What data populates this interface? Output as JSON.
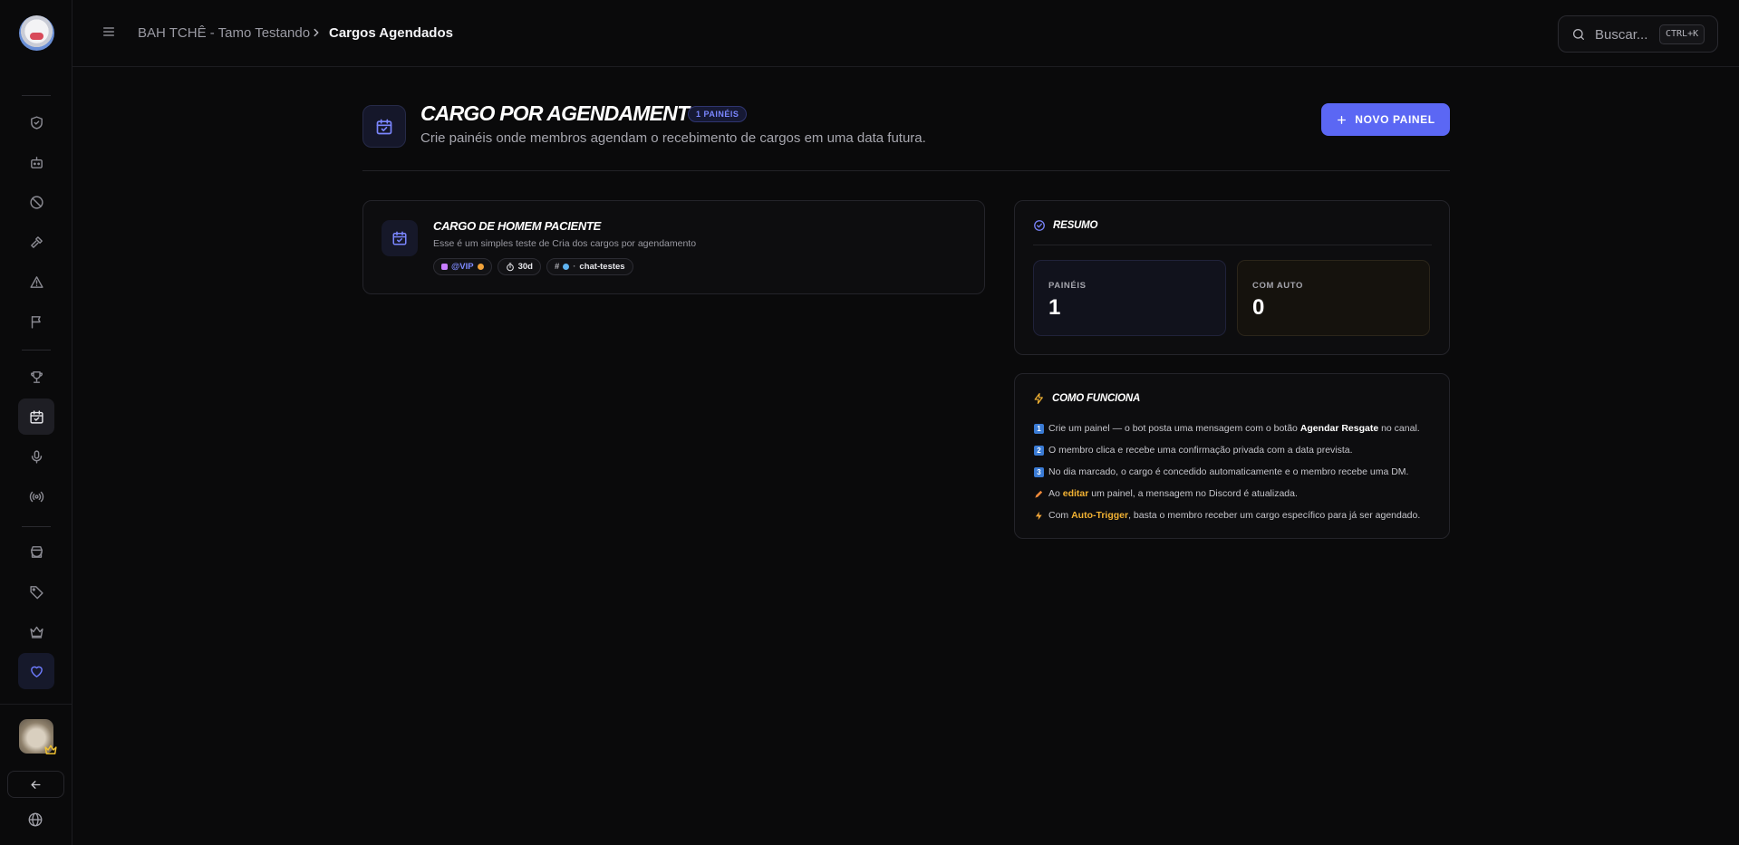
{
  "topbar": {
    "breadcrumb_server": "BAH TCHÊ - Tamo Testando",
    "breadcrumb_current": "Cargos Agendados",
    "search_placeholder": "Buscar...",
    "search_shortcut": "CTRL+K"
  },
  "header": {
    "title": "CARGO POR AGENDAMENTO",
    "badge": "1 PAINÉIS",
    "subtitle": "Crie painéis onde membros agendam o recebimento de cargos em uma data futura.",
    "new_button": "NOVO PAINEL"
  },
  "panel": {
    "title": "CARGO DE HOMEM PACIENTE",
    "description": "Esse é um simples teste de Cria dos cargos por agendamento",
    "role_chip": "@VIP",
    "duration_chip": "30d",
    "channel_chip": "chat-testes"
  },
  "resumo": {
    "title": "RESUMO",
    "stats": [
      {
        "label": "PAINÉIS",
        "value": "1"
      },
      {
        "label": "COM AUTO",
        "value": "0"
      }
    ]
  },
  "como_funciona": {
    "title": "COMO FUNCIONA",
    "steps": [
      {
        "pre": "Crie um painel — o bot posta uma mensagem com o botão ",
        "hl": "Agendar Resgate",
        "post": " no canal."
      },
      {
        "pre": "O membro clica e recebe uma confirmação privada com a data prevista.",
        "hl": "",
        "post": ""
      },
      {
        "pre": "No dia marcado, o cargo é concedido automaticamente e o membro recebe uma DM.",
        "hl": "",
        "post": ""
      },
      {
        "pre": "Ao ",
        "hl": "editar",
        "post": " um painel, a mensagem no Discord é atualizada."
      },
      {
        "pre": "Com ",
        "hl": "Auto-Trigger",
        "post": ", basta o membro receber um cargo específico para já ser agendado."
      }
    ]
  },
  "colors": {
    "accent": "#5b67f4",
    "highlight": "#f2b233",
    "background": "#0a0a0b"
  }
}
